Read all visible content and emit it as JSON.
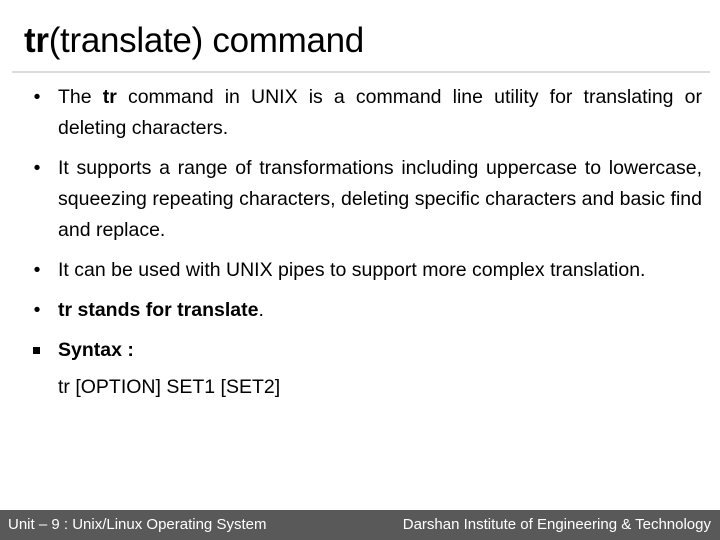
{
  "slide": {
    "title": {
      "bold_part": "tr",
      "rest": "(translate) command"
    },
    "bullets": [
      {
        "marker": "•",
        "segments": [
          {
            "text": "The ",
            "bold": false
          },
          {
            "text": "tr",
            "bold": true
          },
          {
            "text": " command in UNIX is a command line utility for translating or deleting characters.",
            "bold": false
          }
        ]
      },
      {
        "marker": "•",
        "segments": [
          {
            "text": "It supports a range of transformations including uppercase to lowercase, squeezing repeating characters, deleting specific characters and basic find and replace.",
            "bold": false
          }
        ]
      },
      {
        "marker": "•",
        "segments": [
          {
            "text": "It can be used with UNIX pipes to support more complex translation.",
            "bold": false
          }
        ]
      },
      {
        "marker": "•",
        "segments": [
          {
            "text": "tr stands for translate",
            "bold": true
          },
          {
            "text": ".",
            "bold": false
          }
        ]
      }
    ],
    "syntax": {
      "marker": "square-bullet",
      "label": "Syntax :",
      "command": "tr [OPTION] SET1 [SET2]"
    }
  },
  "footer": {
    "left": "Unit – 9 : Unix/Linux Operating System",
    "right": "Darshan Institute of Engineering & Technology",
    "background": "#595959",
    "text_color": "#ffffff"
  }
}
